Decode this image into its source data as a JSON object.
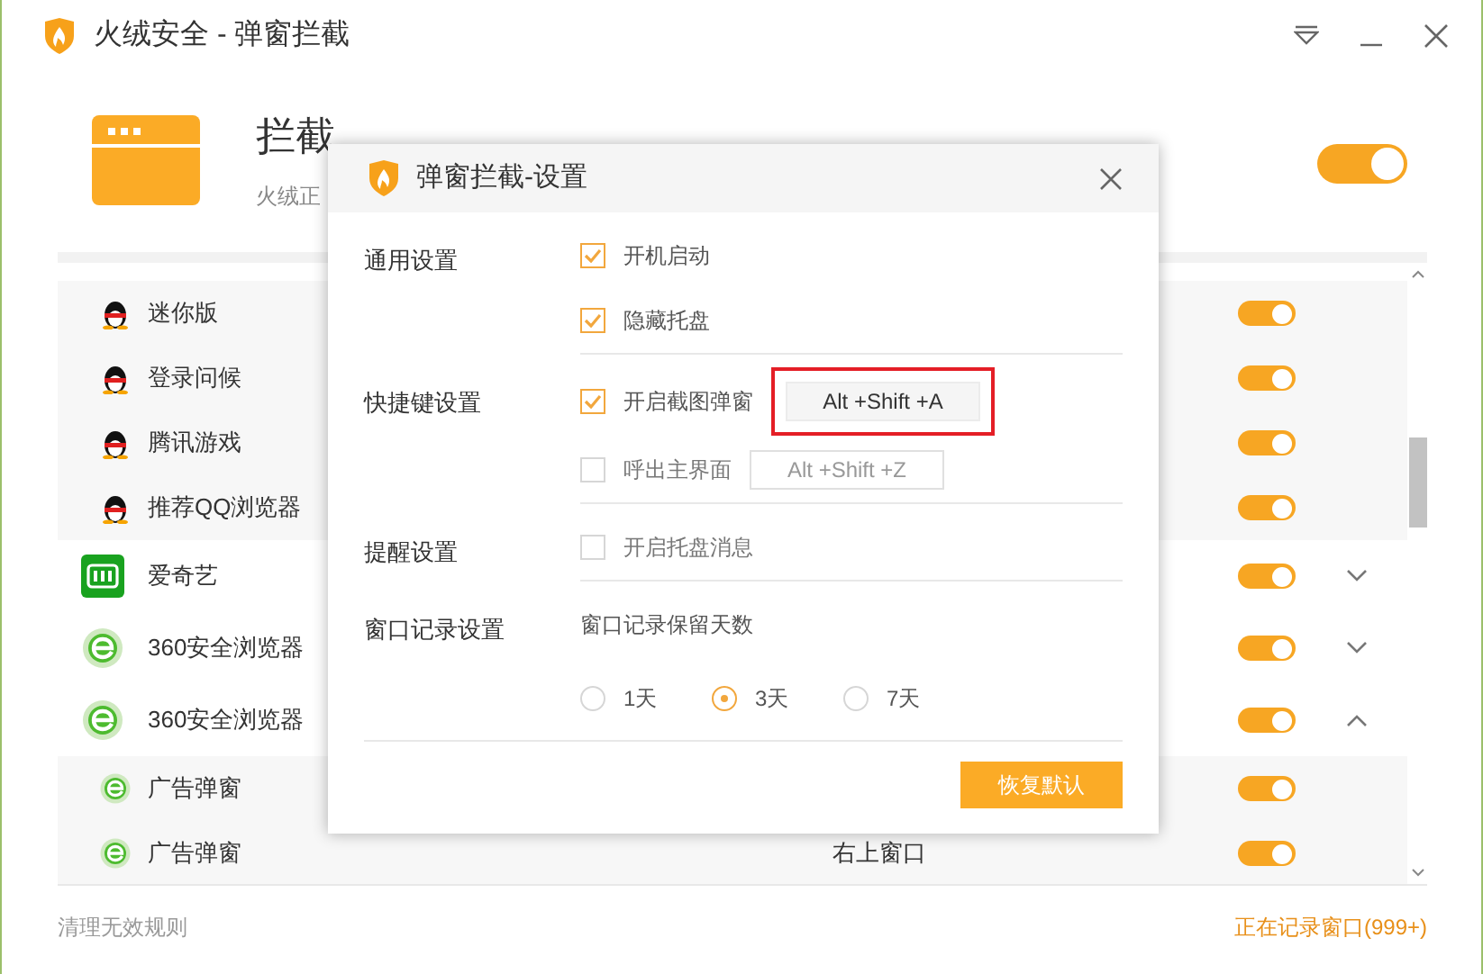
{
  "window": {
    "title": "火绒安全 - 弹窗拦截"
  },
  "header": {
    "title": "拦截",
    "subtitle": "火绒正",
    "enabled": true
  },
  "rules": [
    {
      "kind": "sub",
      "name": "迷你版",
      "on": true
    },
    {
      "kind": "sub",
      "name": "登录问候",
      "on": true
    },
    {
      "kind": "sub",
      "name": "腾讯游戏",
      "on": true
    },
    {
      "kind": "sub",
      "name": "推荐QQ浏览器",
      "on": true
    },
    {
      "kind": "app",
      "name": "爱奇艺",
      "on": true,
      "expanded": false
    },
    {
      "kind": "app",
      "name": "360安全浏览器",
      "on": true,
      "expanded": false
    },
    {
      "kind": "app",
      "name": "360安全浏览器",
      "on": true,
      "expanded": true,
      "children": [
        {
          "name": "广告弹窗",
          "on": true
        },
        {
          "name": "广告弹窗",
          "position": "右上窗口",
          "on": true
        }
      ]
    }
  ],
  "footer": {
    "cleanup_link": "清理无效规则",
    "status": "正在记录窗口(999+)"
  },
  "settings_dialog": {
    "title": "弹窗拦截-设置",
    "sections": [
      {
        "label": "通用设置",
        "items": [
          {
            "kind": "checkbox",
            "label": "开机启动",
            "checked": true
          },
          {
            "kind": "checkbox",
            "label": "隐藏托盘",
            "checked": true
          }
        ]
      },
      {
        "label": "快捷键设置",
        "items": [
          {
            "kind": "hotkey",
            "label": "开启截图弹窗",
            "checked": true,
            "hotkey": "Alt +Shift +A",
            "highlighted": true
          },
          {
            "kind": "hotkey",
            "label": "呼出主界面",
            "checked": false,
            "hotkey": "Alt +Shift +Z"
          }
        ]
      },
      {
        "label": "提醒设置",
        "items": [
          {
            "kind": "checkbox",
            "label": "开启托盘消息",
            "checked": false
          }
        ]
      },
      {
        "label": "窗口记录设置",
        "items": [
          {
            "kind": "radio_group",
            "label": "窗口记录保留天数",
            "options": [
              {
                "label": "1天",
                "selected": false
              },
              {
                "label": "3天",
                "selected": true
              },
              {
                "label": "7天",
                "selected": false
              }
            ]
          }
        ]
      }
    ],
    "reset_button": "恢复默认"
  }
}
